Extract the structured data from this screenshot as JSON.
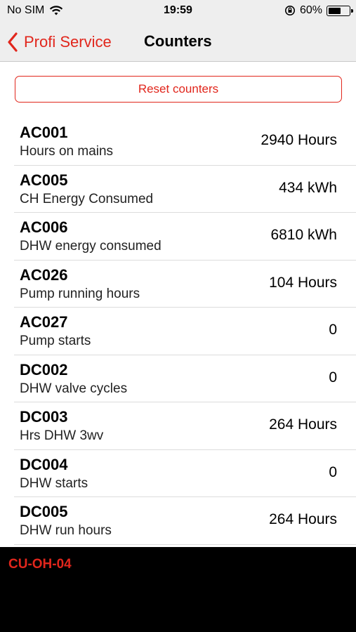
{
  "status": {
    "carrier": "No SIM",
    "time": "19:59",
    "battery_text": "60%",
    "battery_level": 0.6
  },
  "nav": {
    "back_label": "Profi Service",
    "title": "Counters"
  },
  "reset_label": "Reset counters",
  "counters": [
    {
      "code": "AC001",
      "desc": "Hours on mains",
      "value": "2940 Hours"
    },
    {
      "code": "AC005",
      "desc": "CH Energy Consumed",
      "value": "434 kWh"
    },
    {
      "code": "AC006",
      "desc": "DHW energy consumed",
      "value": "6810 kWh"
    },
    {
      "code": "AC026",
      "desc": "Pump running hours",
      "value": "104 Hours"
    },
    {
      "code": "AC027",
      "desc": "Pump starts",
      "value": "0"
    },
    {
      "code": "DC002",
      "desc": "DHW valve cycles",
      "value": "0"
    },
    {
      "code": "DC003",
      "desc": "Hrs DHW 3wv",
      "value": "264 Hours"
    },
    {
      "code": "DC004",
      "desc": "DHW starts",
      "value": "0"
    },
    {
      "code": "DC005",
      "desc": "DHW run hours",
      "value": "264 Hours"
    }
  ],
  "footer_label": "CU-OH-04",
  "colors": {
    "accent": "#e1261c",
    "bar": "#eeeeee",
    "footer": "#000000"
  }
}
